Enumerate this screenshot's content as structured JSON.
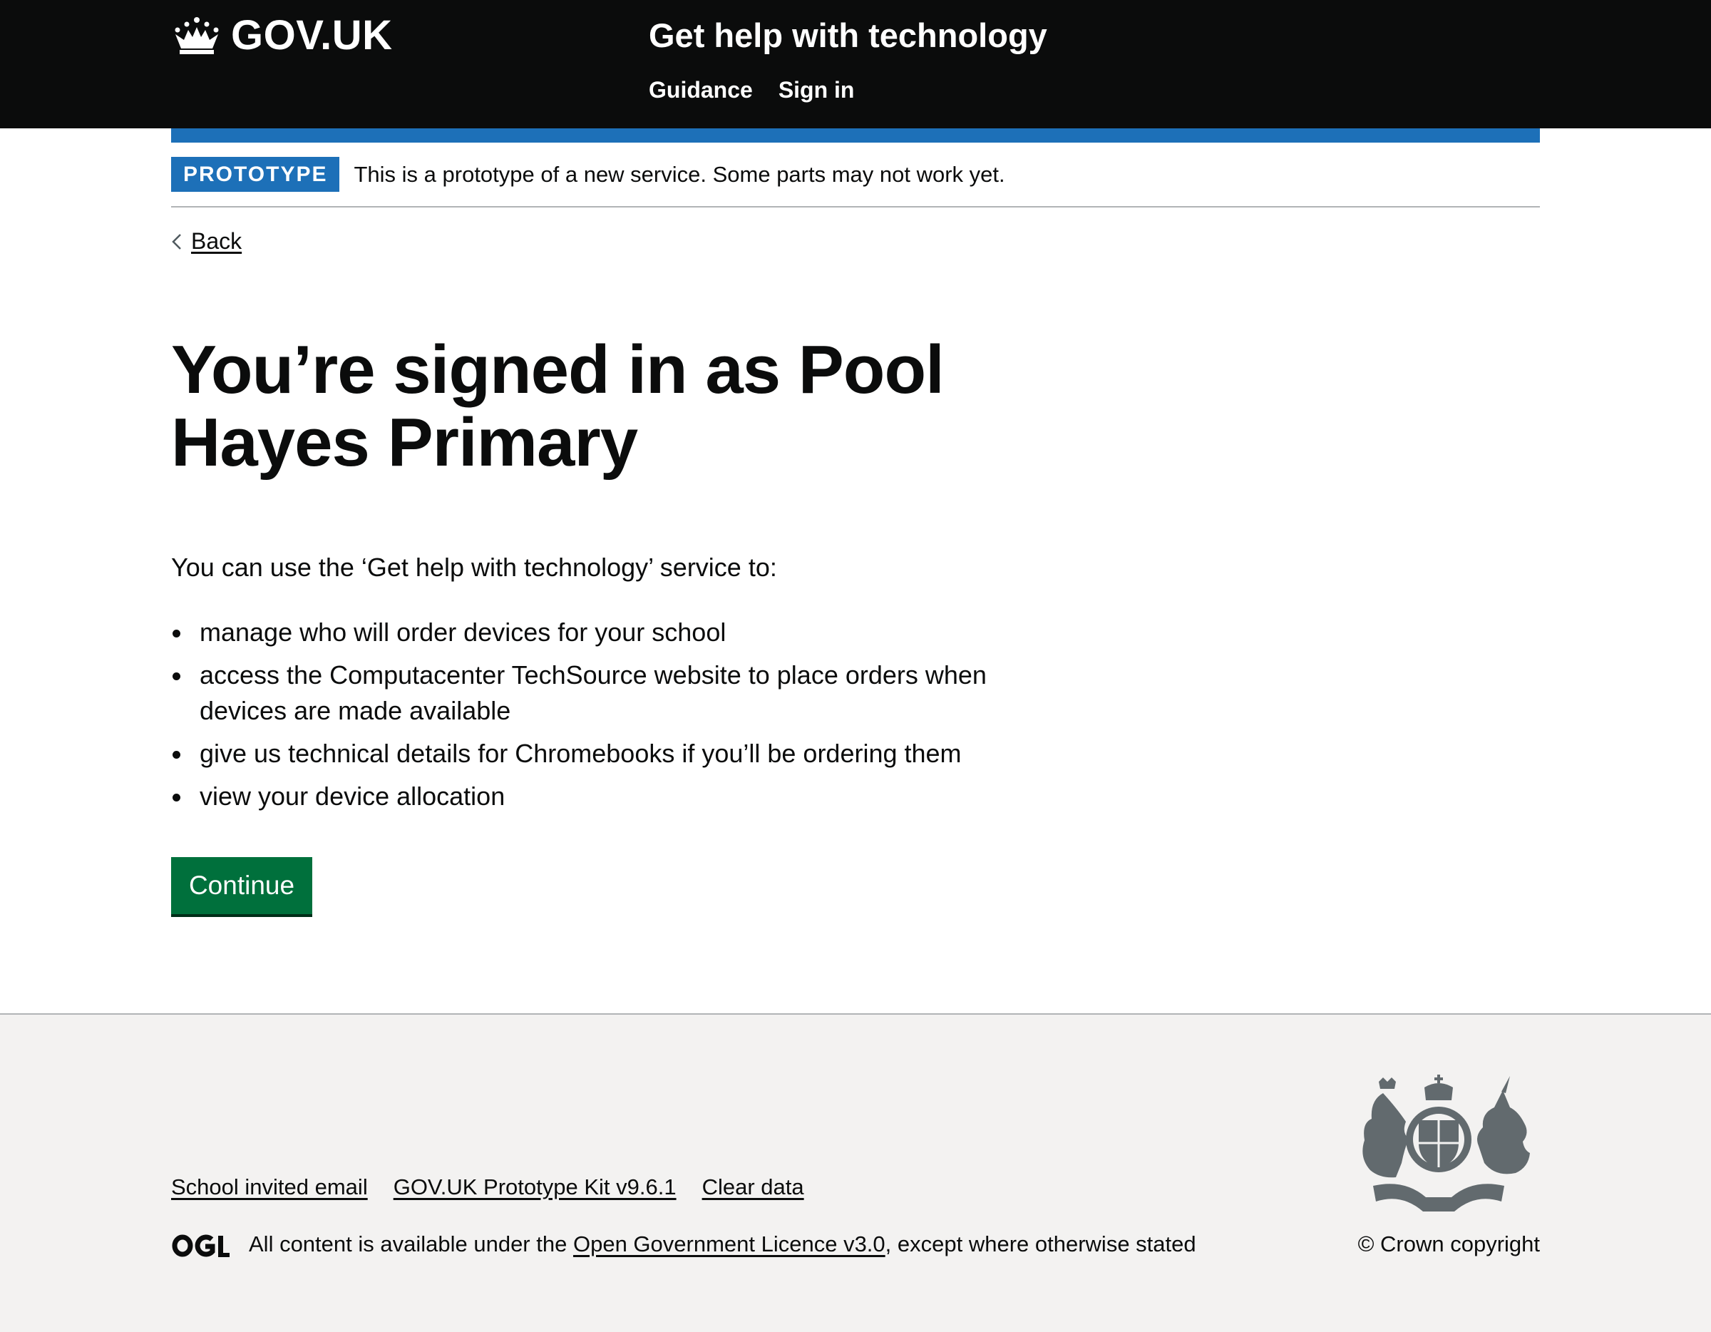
{
  "header": {
    "logo_text": "GOV.UK",
    "service_name": "Get help with technology",
    "nav": [
      "Guidance",
      "Sign in"
    ]
  },
  "phase_banner": {
    "tag": "PROTOTYPE",
    "text": "This is a prototype of a new service. Some parts may not work yet."
  },
  "back_link": "Back",
  "main": {
    "heading": "You’re signed in as Pool Hayes Primary",
    "intro": "You can use the ‘Get help with technology’ service to:",
    "list": [
      "manage who will order devices for your school",
      "access the Computacenter TechSource website to place orders when devices are made available",
      "give us technical details for Chromebooks if you’ll be ordering them",
      "view your device allocation"
    ],
    "button": "Continue"
  },
  "footer": {
    "links": [
      "School invited email",
      "GOV.UK Prototype Kit v9.6.1",
      "Clear data"
    ],
    "licence_before": "All content is available under the",
    "licence_link": "Open Government Licence v3.0",
    "licence_after": ", except where otherwise stated",
    "copyright": "© Crown copyright"
  },
  "colors": {
    "header_bg": "#0b0c0c",
    "brand_blue": "#1d70b8",
    "button_green": "#00703c",
    "footer_bg": "#f3f2f1"
  },
  "icons": [
    "crown-icon",
    "chevron-left-icon",
    "ogl-logo-icon",
    "royal-crest-icon"
  ]
}
